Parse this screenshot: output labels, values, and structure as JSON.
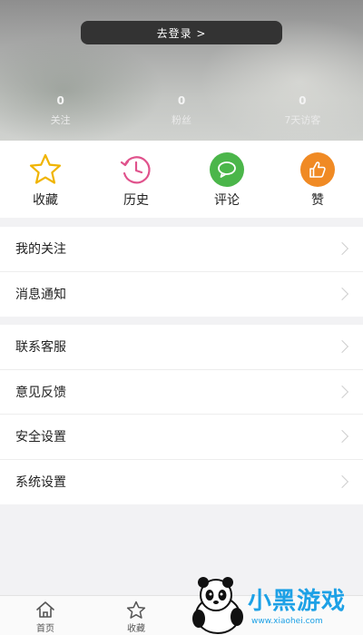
{
  "header": {
    "login_label": "去登录 >",
    "stats": [
      {
        "value": "0",
        "label": "关注"
      },
      {
        "value": "0",
        "label": "粉丝"
      },
      {
        "value": "0",
        "label": "7天访客"
      }
    ]
  },
  "quick_actions": [
    {
      "label": "收藏",
      "icon": "star-icon",
      "color": "#f0b400"
    },
    {
      "label": "历史",
      "icon": "history-icon",
      "color": "#e0528c"
    },
    {
      "label": "评论",
      "icon": "comment-icon",
      "color": "#4bb64a"
    },
    {
      "label": "赞",
      "icon": "thumbs-up-icon",
      "color": "#f08a24"
    }
  ],
  "menu_group_1": [
    "我的关注",
    "消息通知"
  ],
  "menu_group_2": [
    "联系客服",
    "意见反馈",
    "安全设置",
    "系统设置"
  ],
  "tabbar": [
    {
      "label": "首页",
      "icon": "home-icon"
    },
    {
      "label": "收藏",
      "icon": "star-outline-icon"
    }
  ],
  "watermark": {
    "text": "小黑游戏",
    "url": "www.xiaohei.com"
  }
}
